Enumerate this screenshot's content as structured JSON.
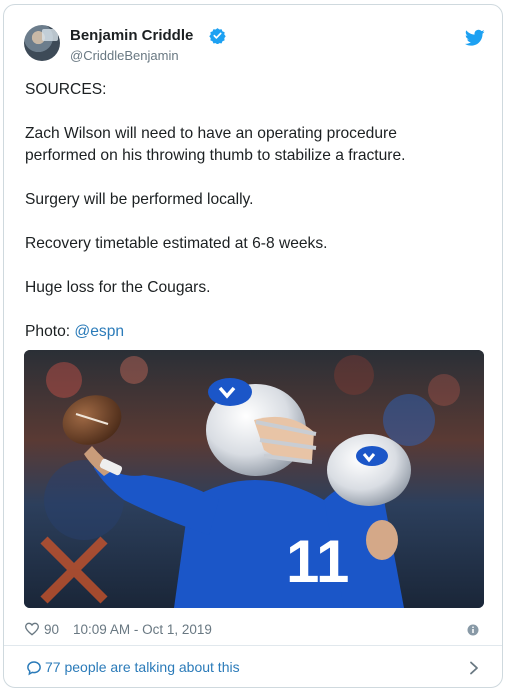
{
  "author": {
    "display_name": "Benjamin Criddle",
    "handle": "@CriddleBenjamin",
    "verified": true
  },
  "tweet": {
    "paragraphs": [
      "SOURCES:",
      "Zach Wilson will need to have an operating procedure performed on his throwing thumb to stabilize a fracture.",
      "Surgery will be performed locally.",
      "Recovery timetable estimated at 6-8 weeks.",
      "Huge loss for the Cougars."
    ],
    "photo_credit_prefix": "Photo: ",
    "photo_credit_link": "@espn"
  },
  "meta": {
    "like_count": "90",
    "timestamp": "10:09 AM - Oct 1, 2019"
  },
  "footer": {
    "conversation_text": "77 people are talking about this"
  },
  "colors": {
    "link": "#2b7bb9",
    "twitter_blue": "#1da1f2",
    "byu_blue": "#1b56c8"
  },
  "icons": [
    "verified-badge-icon",
    "twitter-bird-icon",
    "heart-icon",
    "info-icon",
    "speech-bubble-icon",
    "chevron-right-icon"
  ]
}
